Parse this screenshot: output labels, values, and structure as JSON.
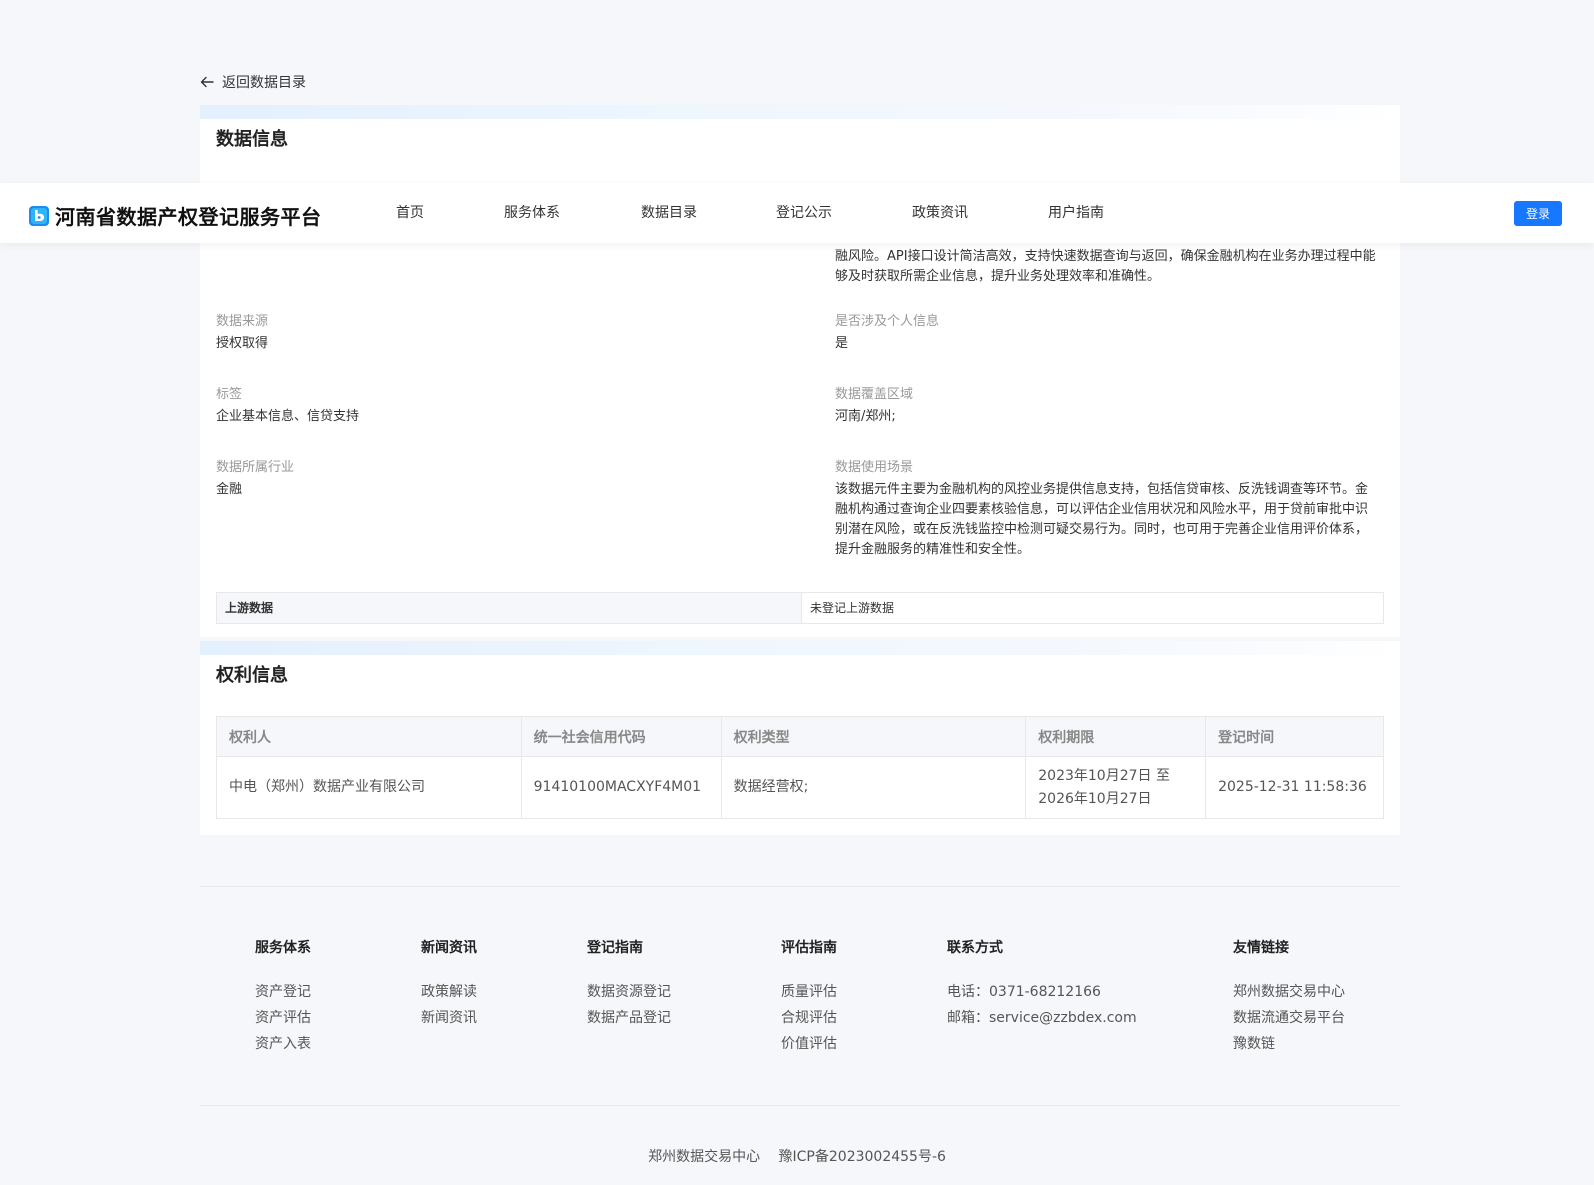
{
  "back_link": {
    "label": "返回数据目录"
  },
  "header": {
    "logo_text": "河南省数据产权登记服务平台",
    "nav": [
      "首页",
      "服务体系",
      "数据目录",
      "登记公示",
      "政策资讯",
      "用户指南"
    ],
    "login_label": "登录"
  },
  "data_info": {
    "title": "数据信息",
    "description_partial": "融风险。API接口设计简洁高效，支持快速数据查询与返回，确保金融机构在业务办理过程中能够及时获取所需企业信息，提升业务处理效率和准确性。",
    "fields": [
      {
        "label": "数据来源",
        "value": "授权取得"
      },
      {
        "label": "是否涉及个人信息",
        "value": "是"
      },
      {
        "label": "标签",
        "value": "企业基本信息、信贷支持"
      },
      {
        "label": "数据覆盖区域",
        "value": "河南/郑州;"
      },
      {
        "label": "数据所属行业",
        "value": "金融"
      },
      {
        "label": "数据使用场景",
        "value": "该数据元件主要为金融机构的风控业务提供信息支持，包括信贷审核、反洗钱调查等环节。金融机构通过查询企业四要素核验信息，可以评估企业信用状况和风险水平，用于贷前审批中识别潜在风险，或在反洗钱监控中检测可疑交易行为。同时，也可用于完善企业信用评价体系，提升金融服务的精准性和安全性。"
      }
    ],
    "upstream": {
      "label": "上游数据",
      "value": "未登记上游数据"
    }
  },
  "rights_info": {
    "title": "权利信息",
    "columns": [
      "权利人",
      "统一社会信用代码",
      "权利类型",
      "权利期限",
      "登记时间"
    ],
    "rows": [
      [
        "中电（郑州）数据产业有限公司",
        "91410100MACXYF4M01",
        "数据经营权;",
        "2023年10月27日 至 2026年10月27日",
        "2025-12-31 11:58:36"
      ]
    ]
  },
  "footer": {
    "columns": [
      {
        "title": "服务体系",
        "links": [
          "资产登记",
          "资产评估",
          "资产入表"
        ]
      },
      {
        "title": "新闻资讯",
        "links": [
          "政策解读",
          "新闻资讯"
        ]
      },
      {
        "title": "登记指南",
        "links": [
          "数据资源登记",
          "数据产品登记"
        ]
      },
      {
        "title": "评估指南",
        "links": [
          "质量评估",
          "合规评估",
          "价值评估"
        ]
      },
      {
        "title": "联系方式",
        "items": [
          "电话：0371-68212166",
          "邮箱：service@zzbdex.com"
        ]
      },
      {
        "title": "友情链接",
        "links": [
          "郑州数据交易中心",
          "数据流通交易平台",
          "豫数链"
        ]
      }
    ],
    "copyright_org": "郑州数据交易中心",
    "icp": "豫ICP备2023002455号-6"
  },
  "colors": {
    "primary": "#1677ff",
    "page_bg": "#f5f7fa"
  }
}
